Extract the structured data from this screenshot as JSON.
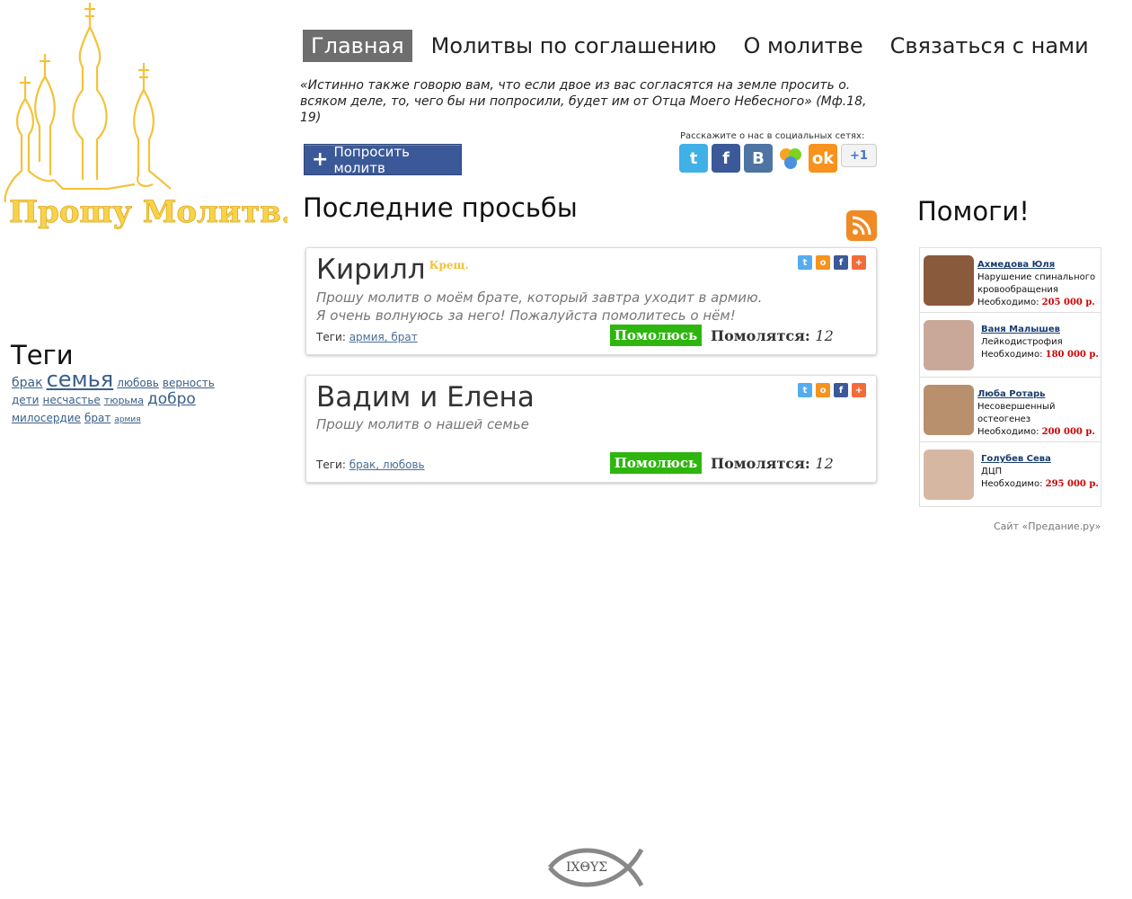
{
  "logo": {
    "text": "Прошу Молитв.ру"
  },
  "nav": [
    {
      "label": "Главная",
      "active": true
    },
    {
      "label": "Молитвы по соглашению",
      "active": false
    },
    {
      "label": "О молитве",
      "active": false
    },
    {
      "label": "Связаться с нами",
      "active": false
    }
  ],
  "quote": "«Истинно также говорю вам, что если двое из вас  согласятся на земле просить  о. всяком деле, то, чего бы ни  попросили, будет им от Отца Моего Небесного» (Мф.18, 19)",
  "ask_button": "Попросить молитв",
  "share": {
    "caption": "Расскажите о нас в социальных сетях:",
    "icons": [
      "twitter-icon",
      "facebook-icon",
      "vk-icon",
      "mailru-icon",
      "odnoklassniki-icon",
      "google-plus-one-icon"
    ],
    "plus_one": "+1"
  },
  "latest_title": "Последние просьбы",
  "requests": [
    {
      "name": "Кирилл",
      "badge": "Крещ.",
      "text1": "Прошу молитв о моём брате, который завтра уходит в армию.",
      "text2": "Я очень волнуюсь за него! Пожалуйста помолитесь о нём!",
      "tags_label": "Теги:",
      "tags": "армия, брат",
      "pray_label": "Помолюсь",
      "count_label": "Помолятся:",
      "count": "12"
    },
    {
      "name": "Вадим и Елена",
      "badge": "",
      "text1": "Прошу молитв о нашей семье",
      "text2": "",
      "tags_label": "Теги:",
      "tags": "брак, любовь",
      "pray_label": "Помолюсь",
      "count_label": "Помолятся:",
      "count": "12"
    }
  ],
  "tags_title": "Теги",
  "tag_cloud": [
    {
      "label": "брак",
      "size": 14
    },
    {
      "label": "семья",
      "size": 24
    },
    {
      "label": "любовь",
      "size": 12
    },
    {
      "label": "верность",
      "size": 12
    },
    {
      "label": "дети",
      "size": 12
    },
    {
      "label": "несчастье",
      "size": 12
    },
    {
      "label": "тюрьма",
      "size": 11
    },
    {
      "label": "добро",
      "size": 17
    },
    {
      "label": "милосердие",
      "size": 12
    },
    {
      "label": "брат",
      "size": 12
    },
    {
      "label": "армия",
      "size": 9
    }
  ],
  "help_title": "Помоги!",
  "help": [
    {
      "name": "Ахмедова Юля",
      "diagnosis": "Нарушение спинального кровообращения",
      "need_label": "Необходимо:",
      "amount": "205 000 р.",
      "photo_color": "#8a5a3c"
    },
    {
      "name": "Ваня Малышев",
      "diagnosis": "Лейкодистрофия",
      "need_label": "Необходимо:",
      "amount": "180 000 р.",
      "photo_color": "#c9a89a"
    },
    {
      "name": "Люба Ротарь",
      "diagnosis": "Несовершенный остеогенез",
      "need_label": "Необходимо:",
      "amount": "200 000 р.",
      "photo_color": "#b8906e"
    },
    {
      "name": "Голубев Сева",
      "diagnosis": "ДЦП",
      "need_label": "Необходимо:",
      "amount": "295 000 р.",
      "photo_color": "#d6b8a2"
    }
  ],
  "site_credit": {
    "prefix": "Сайт ",
    "link": "«Предание.ру»"
  },
  "fish_text": "ΙΧΘΥΣ",
  "colors": {
    "accent": "#3b5998",
    "pray": "#2eb60f",
    "badge": "#f2c23a",
    "amount": "#cc0000",
    "logo": "#f2c23a"
  }
}
